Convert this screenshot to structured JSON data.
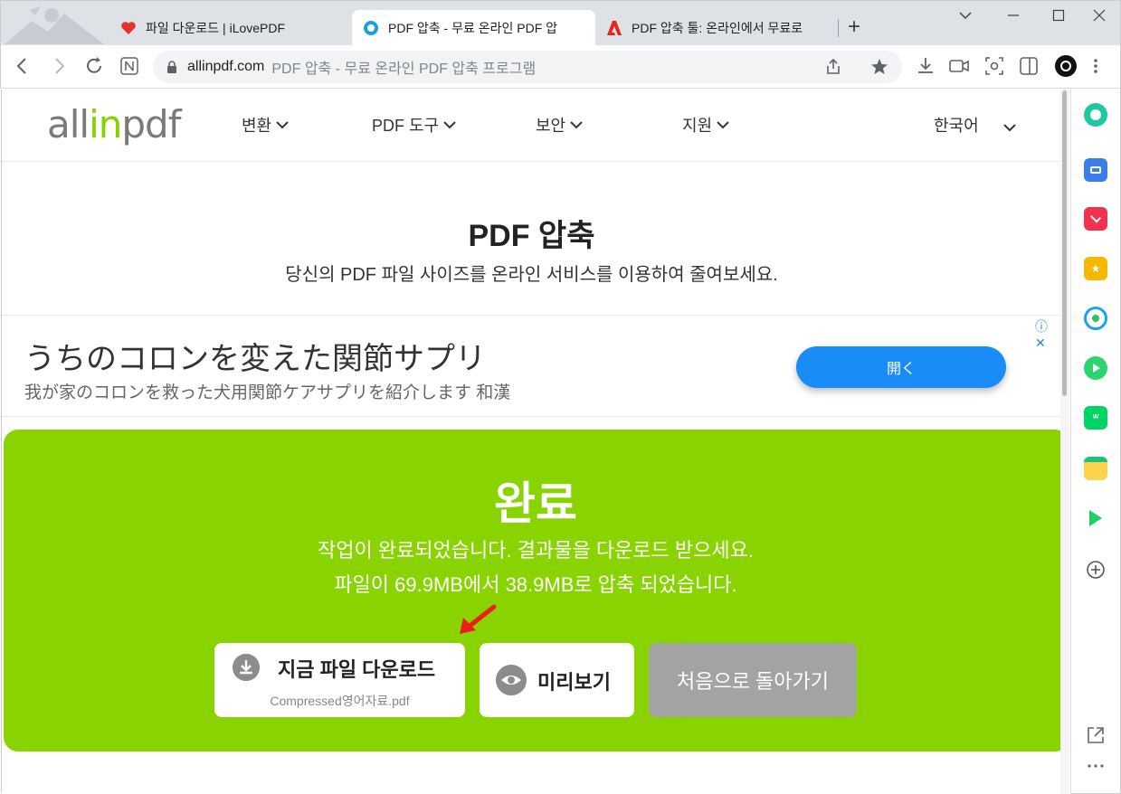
{
  "browser": {
    "tabs": [
      {
        "title": "파일 다운로드 | iLovePDF",
        "favicon": "ilovepdf-heart-icon",
        "color": "#e5322d"
      },
      {
        "title": "PDF 압축 - 무료 온라인 PDF 압",
        "favicon": "allinpdf-icon",
        "color": "#17a2d6",
        "active": true
      },
      {
        "title": "PDF 압축 툴: 온라인에서 무료로",
        "favicon": "adobe-icon",
        "color": "#e8231b"
      }
    ],
    "new_tab_label": "+",
    "window_controls": [
      "⌄",
      "–",
      "☐",
      "✕"
    ],
    "omnibox": {
      "host": "allinpdf.com",
      "page_title": "PDF 압축 - 무료 온라인 PDF 압축 프로그램"
    }
  },
  "site_nav": {
    "logo_left": "all",
    "logo_accent": "in",
    "logo_right": "pdf",
    "items": [
      "변환",
      "PDF 도구",
      "보안",
      "지원"
    ],
    "language": "한국어"
  },
  "hero": {
    "title": "PDF 압축",
    "subtitle": "당신의 PDF 파일 사이즈를 온라인 서비스를 이용하여 줄여보세요."
  },
  "ad": {
    "title": "うちのコロンを変えた関節サプリ",
    "subtitle": "我が家のコロンを救った犬用関節ケアサプリを紹介します 和漢",
    "button": "開く",
    "info": "ⓘ ✕"
  },
  "result": {
    "title": "완료",
    "message": "작업이 완료되었습니다. 결과물을 다운로드 받으세요.",
    "size_message": "파일이 69.9MB에서 38.9MB로 압축 되었습니다.",
    "download_label": "지금 파일 다운로드",
    "file_name": "Compressed영어자료.pdf",
    "preview_label": "미리보기",
    "restart_label": "처음으로 돌아가기",
    "panel_color": "#88d300"
  }
}
